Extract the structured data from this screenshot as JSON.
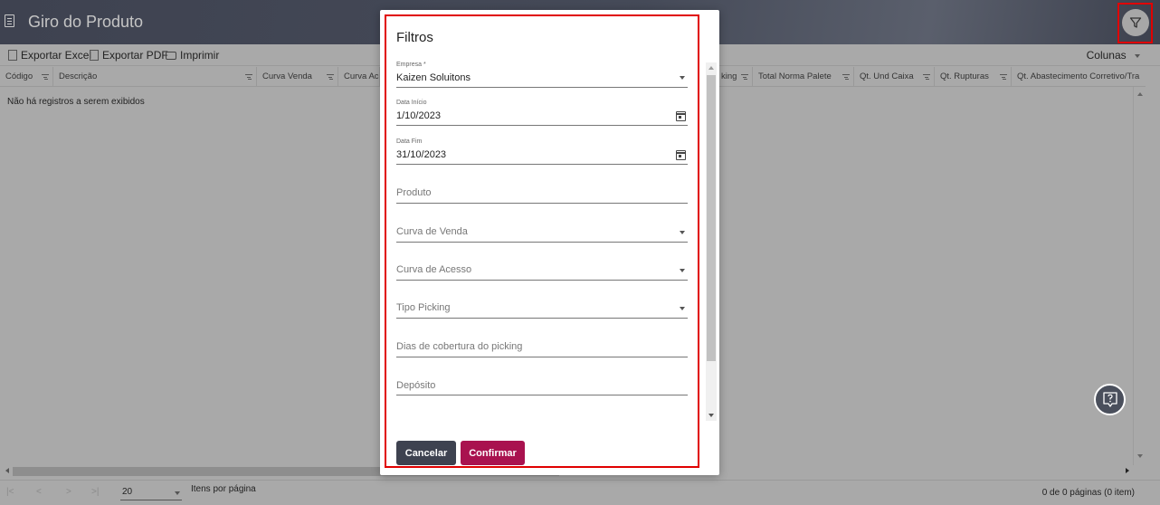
{
  "header": {
    "title": "Giro do Produto"
  },
  "toolbar": {
    "export_excel": "Exportar Excel",
    "export_pdf": "Exportar PDF",
    "print": "Imprimir",
    "columns": "Colunas"
  },
  "grid": {
    "columns": [
      "Código",
      "Descrição",
      "Curva Venda",
      "Curva Ace",
      "king",
      "Total Norma Palete",
      "Qt. Und Caixa",
      "Qt. Rupturas",
      "Qt. Abastecimento Corretivo/Tra"
    ],
    "empty_message": "Não há registros a serem exibidos"
  },
  "pager": {
    "first": "|<",
    "prev": "<",
    "next": ">",
    "last": ">|",
    "page_size": "20",
    "page_size_label": "Itens por página",
    "info": "0 de 0 páginas (0 item)"
  },
  "modal": {
    "title": "Filtros",
    "fields": [
      {
        "label": "Empresa *",
        "value": "Kaizen Soluitons",
        "placeholder": ""
      },
      {
        "label": "Data Início",
        "value": "1/10/2023",
        "placeholder": ""
      },
      {
        "label": "Data Fim",
        "value": "31/10/2023",
        "placeholder": ""
      },
      {
        "label": "",
        "value": "",
        "placeholder": "Produto"
      },
      {
        "label": "",
        "value": "",
        "placeholder": "Curva de Venda"
      },
      {
        "label": "",
        "value": "",
        "placeholder": "Curva de Acesso"
      },
      {
        "label": "",
        "value": "",
        "placeholder": "Tipo Picking"
      },
      {
        "label": "",
        "value": "",
        "placeholder": "Dias de cobertura do picking"
      },
      {
        "label": "",
        "value": "",
        "placeholder": "Depósito"
      }
    ],
    "cancel": "Cancelar",
    "confirm": "Confirmar"
  },
  "colors": {
    "header_bg": "#454a58",
    "overlay": "#a9a9a9",
    "confirm": "#a9124f",
    "cancel": "#3e4250",
    "highlight": "#e00000"
  },
  "icons": [
    "document-icon",
    "filter-icon",
    "excel-icon",
    "pdf-icon",
    "print-icon",
    "help-icon",
    "calendar-icon",
    "chevron-down-icon"
  ]
}
